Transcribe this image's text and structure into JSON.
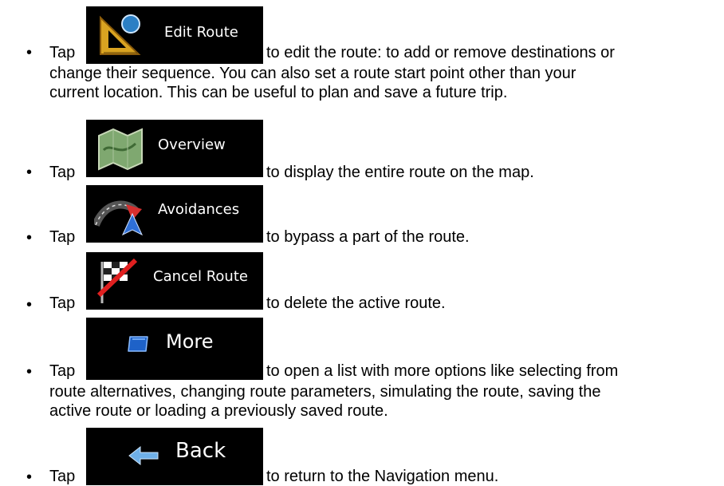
{
  "bullet_symbol": "•",
  "tap_word": "Tap",
  "items": [
    {
      "button_label": "Edit Route",
      "icon": "set-square-ruler-icon",
      "text_first_line": "to edit the route: to add or remove destinations or",
      "text_continuation": [
        "change their sequence. You can also set a route start point other than your",
        "current location. This can be useful to plan and save a future trip."
      ]
    },
    {
      "button_label": "Overview",
      "icon": "map-icon",
      "text_first_line": "to display the entire route on the map.",
      "text_continuation": []
    },
    {
      "button_label": "Avoidances",
      "icon": "detour-road-icon",
      "text_first_line": "to bypass a part of the route.",
      "text_continuation": []
    },
    {
      "button_label": "Cancel Route",
      "icon": "checkered-flag-crossed-icon",
      "text_first_line": "to delete the active route.",
      "text_continuation": []
    },
    {
      "button_label": "More",
      "icon": "blue-rounded-square-icon",
      "text_first_line": "to open a list with more options like selecting from",
      "text_continuation": [
        "route alternatives, changing route parameters, simulating the route, saving the",
        "active route or loading a previously saved route."
      ]
    },
    {
      "button_label": "Back",
      "icon": "back-arrow-icon",
      "text_first_line": "to return to the Navigation menu.",
      "text_continuation": []
    }
  ]
}
